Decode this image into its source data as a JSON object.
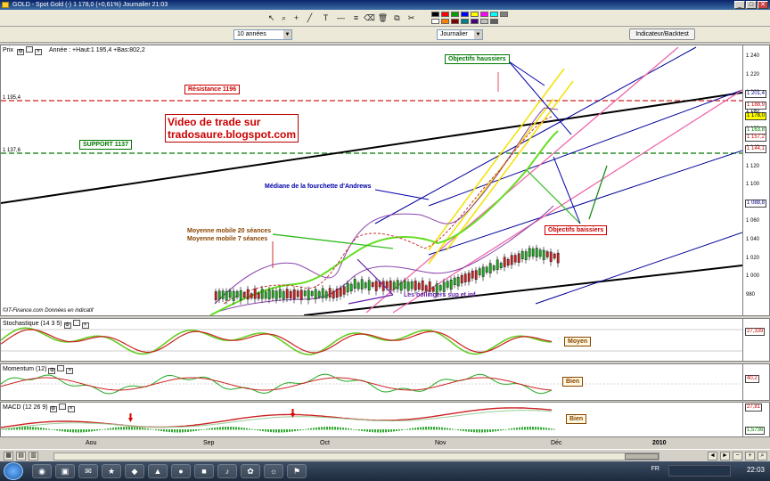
{
  "window": {
    "title": "GOLD - Spot Gold (-)   1 178,0 (+0,61%)   Journalier  21:03",
    "min": "_",
    "max": "□",
    "close": "✕"
  },
  "toolbar": {
    "icons": [
      "cursor-icon",
      "zoom-icon",
      "crosshair-icon",
      "line-icon",
      "hline-icon",
      "text-icon",
      "fibo-icon",
      "eraser-icon",
      "trash-icon",
      "copy-icon",
      "cut-icon"
    ],
    "glyphs": [
      "↖",
      "⌕",
      "+",
      "╱",
      "T",
      "―",
      "≡",
      "⌫",
      "🗑",
      "⧉",
      "✂"
    ],
    "swatches": [
      "#000000",
      "#ff0000",
      "#00a000",
      "#0000ff",
      "#ffff00",
      "#ff00ff",
      "#00ffff",
      "#808080",
      "#ffffff",
      "#ff8000",
      "#800000",
      "#008080",
      "#400080",
      "#c0c0c0",
      "#606060"
    ]
  },
  "controls": {
    "period": "10 années",
    "interval": "Journalier",
    "indicator_button": "Indicateur/Backtest"
  },
  "main": {
    "header": "Prix",
    "info": "Année : +Haut:1 195,4 +Bas:802,2",
    "credit": "©IT-Finance.com  Données en indicatif",
    "price_ticks": [
      "1 240",
      "1 220",
      "1 200",
      "1 180",
      "1 160",
      "1 140",
      "1 120",
      "1 100",
      "1 080",
      "1 060",
      "1 040",
      "1 020",
      "1 000",
      "980"
    ],
    "badges": [
      {
        "text": "1 201,4",
        "color": "#000080"
      },
      {
        "text": "1 188,9",
        "color": "#cc0000"
      },
      {
        "text": "1 178,0",
        "color": "#000000",
        "bg": "#ffff00"
      },
      {
        "text": "1 163,8",
        "color": "#008000"
      },
      {
        "text": "1 157,2",
        "color": "#cc0000"
      },
      {
        "text": "1 144,1",
        "color": "#cc0000"
      },
      {
        "text": "1 088,8",
        "color": "#000080"
      }
    ],
    "level_resistance": "1 195,4",
    "level_support": "1 137,6",
    "resistance_label": "Résistance 1196",
    "support_label": "SUPPORT 1137",
    "promo_line1": "Video de trade sur",
    "promo_line2": "tradosaure.blogspot.com",
    "target_up": "Objectifs haussiers",
    "target_down": "Objectifs baissiers",
    "median_label": "Médiane de la fourchette d'Andrews",
    "ma20": "Moyenne mobile 20 séances",
    "ma7": "Moyenne mobile 7 séances",
    "bollinger": "Les bollingers sup et inf"
  },
  "stochastic": {
    "header": "Stochastique (14 3 5)",
    "value": "27,339",
    "verdict": "Moyen"
  },
  "momentum": {
    "header": "Momentum (12)",
    "value": "40,2",
    "verdict": "Bien"
  },
  "macd": {
    "header": "MACD (12 26 9)",
    "value1": "27,81",
    "value2": "1,5736",
    "verdict": "Bien"
  },
  "xaxis": {
    "months": [
      "Aou",
      "Sep",
      "Oct",
      "Nov",
      "Déc",
      "2010"
    ]
  },
  "taskbar": {
    "time": "22:03",
    "lang": "FR"
  }
}
